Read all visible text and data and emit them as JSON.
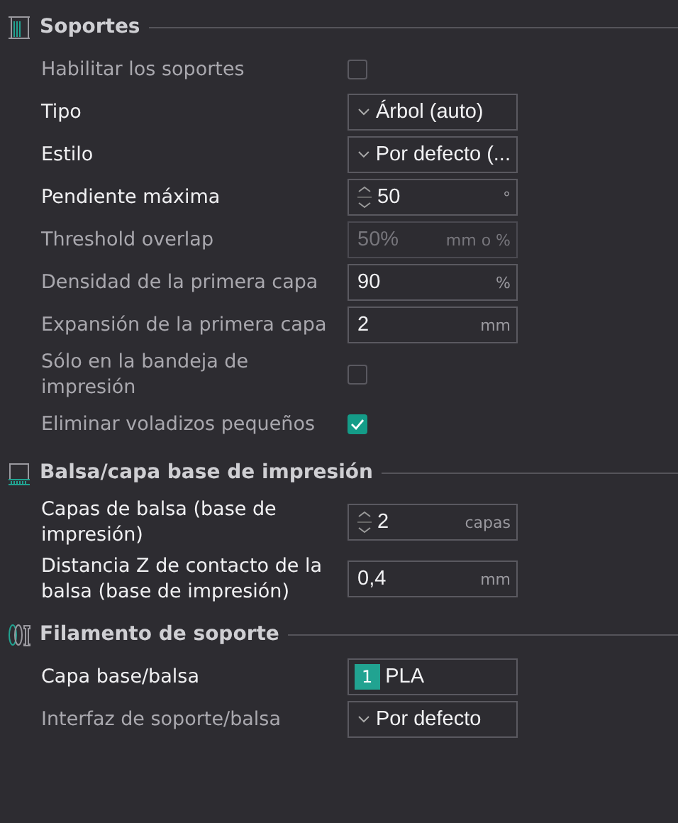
{
  "sections": [
    {
      "title": "Soportes",
      "rows": [
        {
          "kind": "checkbox",
          "label": "Habilitar los soportes",
          "modified": false,
          "checked": false
        },
        {
          "kind": "dropdown",
          "label": "Tipo",
          "modified": true,
          "value": "Árbol (auto)"
        },
        {
          "kind": "dropdown",
          "label": "Estilo",
          "modified": true,
          "value": "Por defecto (..."
        },
        {
          "kind": "spin",
          "label": "Pendiente máxima",
          "modified": true,
          "value": "50",
          "unit": "°"
        },
        {
          "kind": "number",
          "label": "Threshold overlap",
          "modified": false,
          "disabled": true,
          "value": "50%",
          "unit": "mm o %"
        },
        {
          "kind": "number",
          "label": "Densidad de la primera capa",
          "modified": false,
          "disabled": false,
          "value": "90",
          "unit": "%"
        },
        {
          "kind": "number",
          "label": "Expansión de la primera capa",
          "modified": false,
          "disabled": false,
          "value": "2",
          "unit": "mm"
        },
        {
          "kind": "checkbox",
          "label": "Sólo en la bandeja de impresión",
          "modified": false,
          "checked": false
        },
        {
          "kind": "checkbox",
          "label": "Eliminar voladizos pequeños",
          "modified": false,
          "checked": true
        }
      ]
    },
    {
      "title": "Balsa/capa base de impresión",
      "rows": [
        {
          "kind": "spin",
          "label": "Capas de balsa (base de impresión)",
          "modified": true,
          "value": "2",
          "unit": "capas"
        },
        {
          "kind": "number",
          "label": "Distancia Z de contacto de la balsa (base de impresión)",
          "modified": true,
          "disabled": false,
          "value": "0,4",
          "unit": "mm"
        }
      ]
    },
    {
      "title": "Filamento de soporte",
      "rows": [
        {
          "kind": "filament",
          "label": "Capa base/balsa",
          "modified": true,
          "badge": "1",
          "value": "PLA",
          "color": "#21a391"
        },
        {
          "kind": "dropdown",
          "label": "Interfaz de soporte/balsa",
          "modified": false,
          "value": "Por defecto"
        }
      ]
    }
  ]
}
